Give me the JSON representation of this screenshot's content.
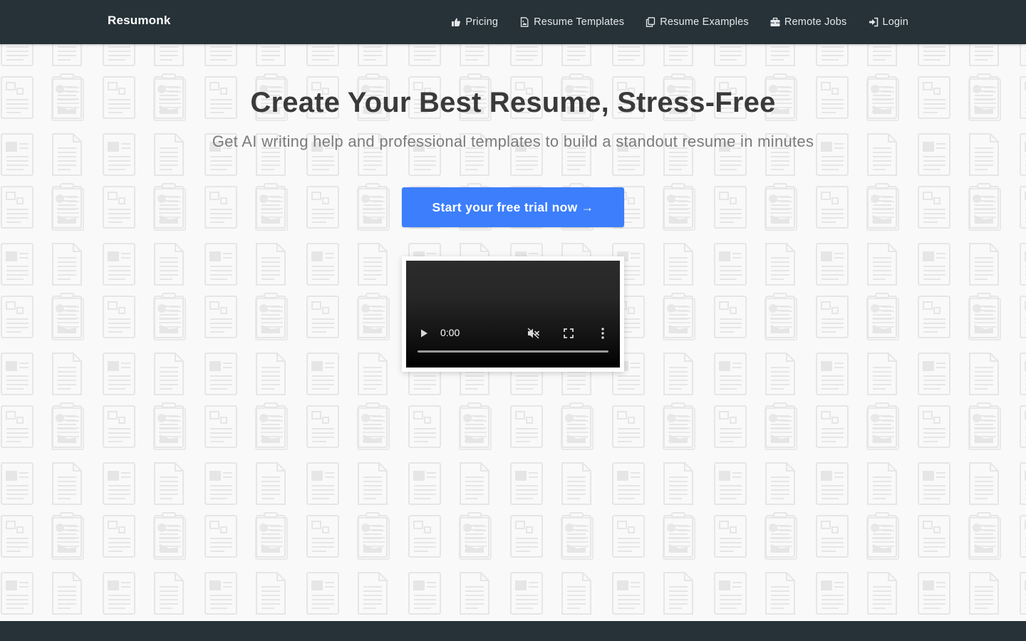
{
  "brand": {
    "name": "Resumonk"
  },
  "nav": {
    "items": [
      {
        "label": "Pricing",
        "icon": "thumbs-up-icon"
      },
      {
        "label": "Resume Templates",
        "icon": "document-image-icon"
      },
      {
        "label": "Resume Examples",
        "icon": "copy-documents-icon"
      },
      {
        "label": "Remote Jobs",
        "icon": "briefcase-icon"
      },
      {
        "label": "Login",
        "icon": "sign-in-icon"
      }
    ]
  },
  "hero": {
    "title": "Create Your Best Resume, Stress-Free",
    "subtitle": "Get AI writing help and professional templates to build a standout resume in minutes",
    "cta_label": "Start your free trial now →"
  },
  "video": {
    "time": "0:00",
    "progress": 0,
    "controls": [
      "play-icon",
      "mute-icon",
      "fullscreen-icon",
      "more-options-icon"
    ]
  },
  "colors": {
    "navbar": "#263238",
    "page_background": "#f9f9f9",
    "pattern": "#e6e6e6",
    "cta": "#3c7efc",
    "headline": "#3a3a3a",
    "subheadline": "#7b7b7b"
  }
}
